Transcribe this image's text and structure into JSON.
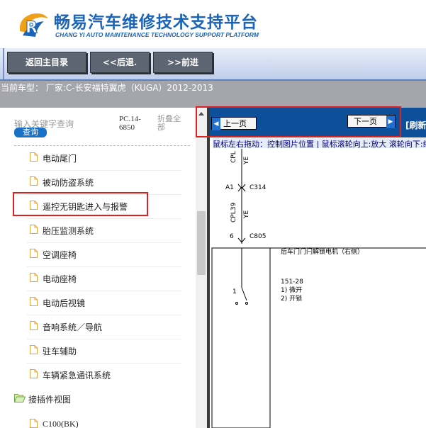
{
  "header": {
    "title": "畅易汽车维修技术支持平台",
    "subtitle": "CHANG YI AUTO MAINTENANCE TECHNOLOGY SUPPORT PLATFORM"
  },
  "toolbar": {
    "home_label": "返回主目录",
    "back_label": "<<后退.",
    "forward_label": ">>前进"
  },
  "vehicle": {
    "text": "当前车型： 厂家:C-长安福特翼虎（KUGA）2012-2013"
  },
  "sidebar": {
    "keyword_placeholder": "输入关键字查询",
    "search_label": "查询",
    "pc_code": "PC.14-6850",
    "collapse_label": "折叠全部",
    "items": [
      {
        "label": "电动尾门"
      },
      {
        "label": "被动防盗系统"
      },
      {
        "label": "遥控无钥匙进入与报警"
      },
      {
        "label": "胎压监测系统"
      },
      {
        "label": "空调座椅"
      },
      {
        "label": "电动座椅"
      },
      {
        "label": "电动后视镜"
      },
      {
        "label": "音响系统／导航"
      },
      {
        "label": "驻车辅助"
      },
      {
        "label": "车辆紧急通讯系统"
      }
    ],
    "folder": {
      "label": "接插件视图"
    },
    "connector": {
      "label": "C100(BK)"
    }
  },
  "viewer": {
    "prev_label": "上一页",
    "next_label": "下一页",
    "refresh_label": "[刷新",
    "hint": "鼠标左右拖动：控制图片位置 | 鼠标滚轮向上:放大  滚轮向下:缩小"
  },
  "diagram": {
    "wire1": "CPL",
    "wire1_color": "YE",
    "pin1": "A1",
    "connector1": "C314",
    "wire2": "CPL39",
    "wire2_color": "YE",
    "pin2": "6",
    "connector2": "C805",
    "component": "后车门门闩解锁电机（右侧）",
    "switch_code": "151-28",
    "state1": "1) 微开",
    "state2": "2) 开锁",
    "pin3": "1"
  },
  "colors": {
    "brand": "#1b64b8",
    "nav": "#0e4f9a",
    "highlight": "#e02020"
  }
}
